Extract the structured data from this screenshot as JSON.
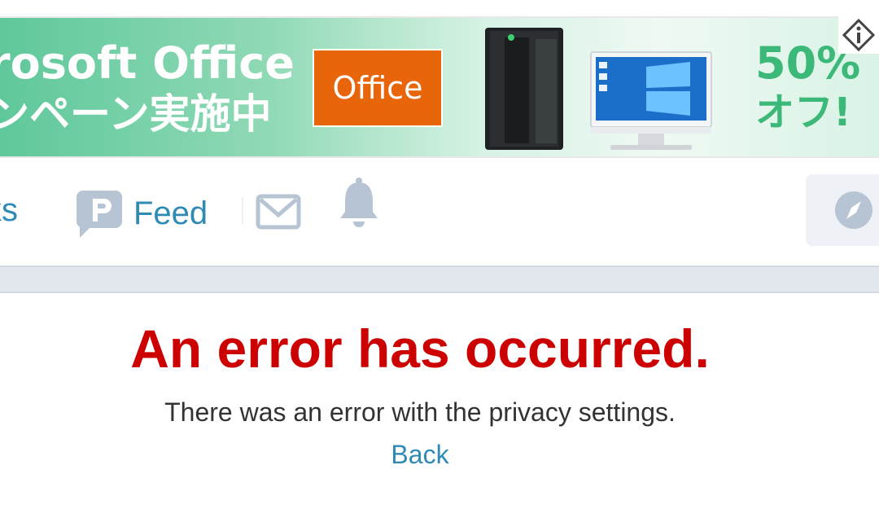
{
  "ad": {
    "headline": "rosoft Office",
    "subline": "ンペーン実施中",
    "office_label": "Office",
    "discount_percent": "50%",
    "discount_off": "オフ!",
    "info_icon": "info-icon",
    "colors": {
      "banner_green": "#5fc89a",
      "office_orange": "#e8650a",
      "discount_green": "#3cb878"
    }
  },
  "nav": {
    "links_label": "ks",
    "feed_label": "Feed",
    "feed_icon": "feed-icon",
    "mail_icon": "mail-icon",
    "bell_icon": "bell-icon",
    "explore_icon": "compass-icon",
    "link_color": "#2f8ab5",
    "icon_color": "#b6c4d3"
  },
  "error": {
    "title": "An error has occurred.",
    "message": "There was an error with the privacy settings.",
    "back_label": "Back",
    "title_color": "#cc0000"
  }
}
